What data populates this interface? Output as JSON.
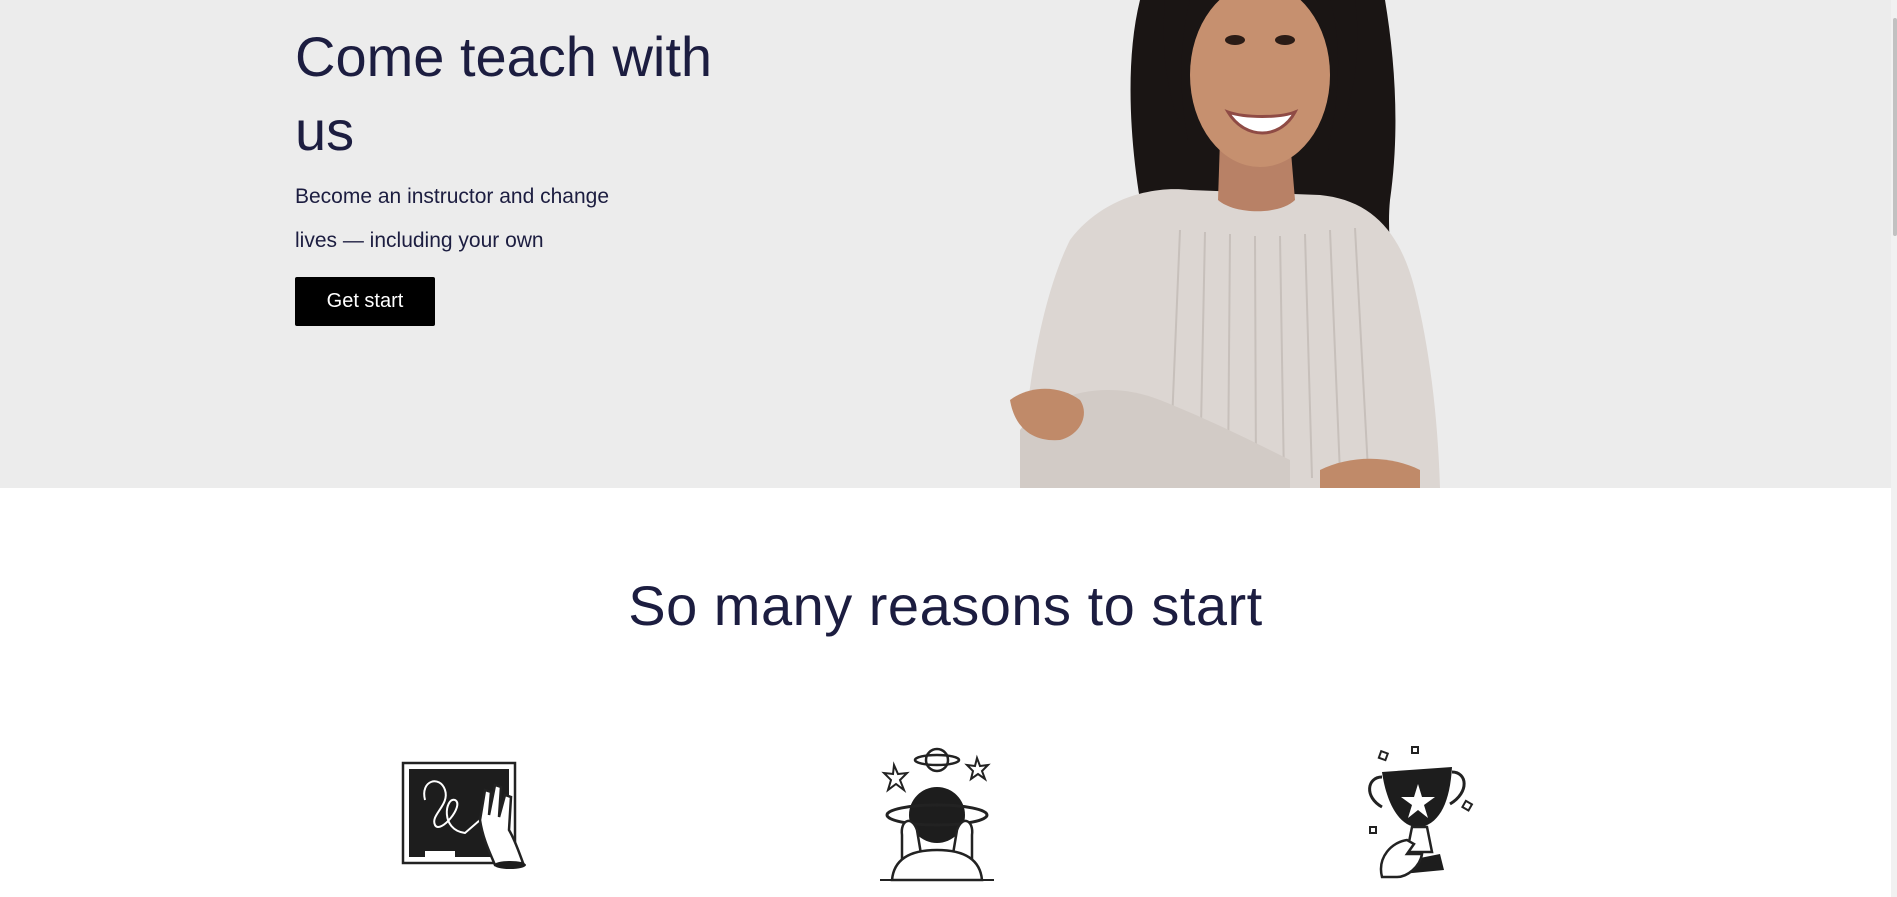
{
  "hero": {
    "title": "Come teach with us",
    "subtitle": "Become an instructor and change lives — including your own",
    "cta_label": "Get start",
    "image": "smiling-instructor-photo",
    "background_color": "#ececec",
    "text_color": "#1c1d40",
    "button_color": "#000000"
  },
  "reasons": {
    "title": "So many reasons to start",
    "icons": [
      "chalkboard-hand-icon",
      "person-planet-stars-icon",
      "trophy-hand-icon"
    ]
  }
}
